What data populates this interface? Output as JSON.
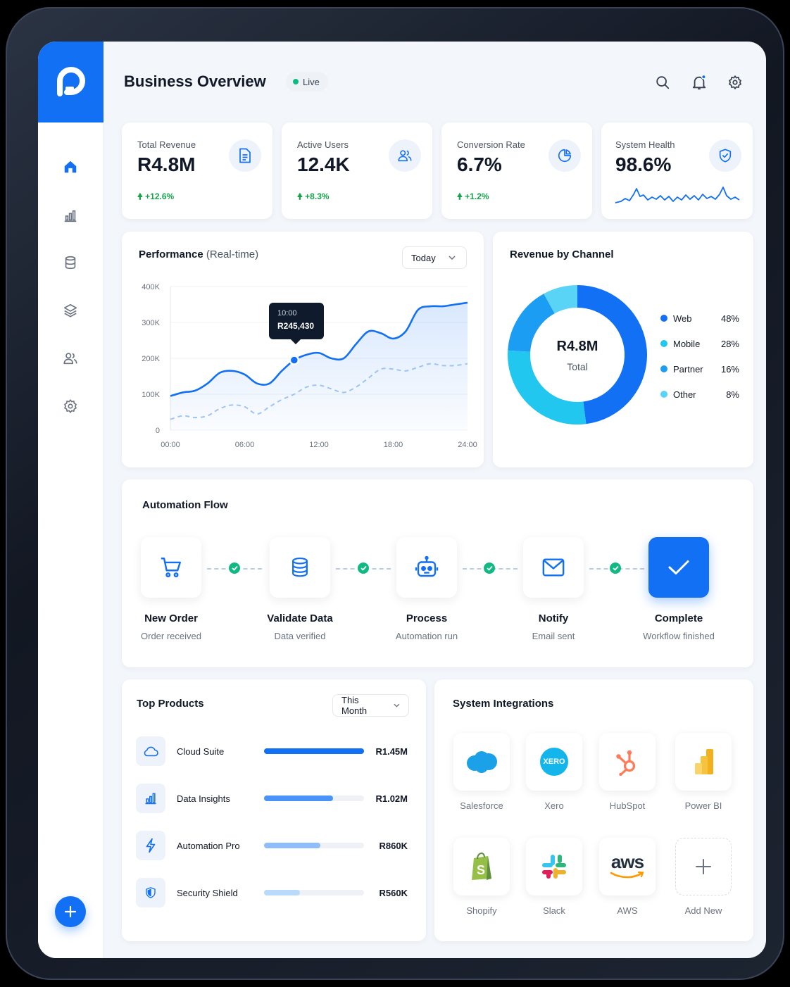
{
  "header": {
    "title": "Business Overview",
    "live_label": "Live"
  },
  "icons": {
    "header": [
      "search-icon",
      "bell-icon",
      "gear-icon"
    ],
    "sidebar": [
      "home-icon",
      "bar-chart-icon",
      "database-icon",
      "layers-icon",
      "users-icon",
      "gear-icon"
    ],
    "fab": "plus-icon"
  },
  "colors": {
    "primary": "#1270f5",
    "positive": "#16a34a",
    "success": "#10b981",
    "background": "#f3f6fb"
  },
  "stats": [
    {
      "label": "Total Revenue",
      "value": "R4.8M",
      "change": "+12.6%",
      "icon": "document-icon"
    },
    {
      "label": "Active Users",
      "value": "12.4K",
      "change": "+8.3%",
      "icon": "users-icon"
    },
    {
      "label": "Conversion Rate",
      "value": "6.7%",
      "change": "+1.2%",
      "icon": "pie-icon"
    },
    {
      "label": "System Health",
      "value": "98.6%",
      "icon": "shield-check-icon"
    }
  ],
  "performance": {
    "title": "Performance",
    "subtitle": "(Real-time)",
    "range": "Today",
    "tooltip": {
      "time": "10:00",
      "value": "R245,430"
    }
  },
  "chart_data": {
    "type": "area",
    "x": [
      "00:00",
      "01:00",
      "02:00",
      "03:00",
      "04:00",
      "05:00",
      "06:00",
      "07:00",
      "08:00",
      "09:00",
      "10:00",
      "11:00",
      "12:00",
      "13:00",
      "14:00",
      "15:00",
      "16:00",
      "17:00",
      "18:00",
      "19:00",
      "20:00",
      "21:00",
      "22:00",
      "23:00",
      "24:00"
    ],
    "x_ticks": [
      "00:00",
      "06:00",
      "12:00",
      "18:00",
      "24:00"
    ],
    "y_ticks": [
      "0",
      "100K",
      "200K",
      "300K",
      "400K"
    ],
    "ylim": [
      0,
      400000
    ],
    "series": [
      {
        "values": [
          95000,
          105000,
          110000,
          130000,
          160000,
          165000,
          155000,
          130000,
          130000,
          165000,
          195000,
          210000,
          215000,
          200000,
          200000,
          240000,
          275000,
          270000,
          255000,
          275000,
          335000,
          345000,
          345000,
          350000,
          355000
        ],
        "style": "solid-area"
      },
      {
        "values": [
          30000,
          40000,
          35000,
          40000,
          60000,
          70000,
          65000,
          45000,
          65000,
          85000,
          100000,
          120000,
          125000,
          115000,
          105000,
          120000,
          145000,
          170000,
          170000,
          165000,
          175000,
          185000,
          180000,
          180000,
          185000
        ],
        "style": "dashed"
      }
    ],
    "highlight": {
      "x": "10:00",
      "y": 195000
    }
  },
  "revenue_channel": {
    "title": "Revenue by Channel",
    "center_value": "R4.8M",
    "center_label": "Total",
    "channels": [
      {
        "name": "Web",
        "pct": 48,
        "label": "48%",
        "color": "#1270f5"
      },
      {
        "name": "Mobile",
        "pct": 28,
        "label": "28%",
        "color": "#22c7f0"
      },
      {
        "name": "Partner",
        "pct": 16,
        "label": "16%",
        "color": "#1a9df2"
      },
      {
        "name": "Other",
        "pct": 8,
        "label": "8%",
        "color": "#59d3f6"
      }
    ]
  },
  "automation": {
    "title": "Automation Flow",
    "steps": [
      {
        "name": "New Order",
        "sub": "Order received",
        "icon": "cart-icon"
      },
      {
        "name": "Validate Data",
        "sub": "Data verified",
        "icon": "database-icon"
      },
      {
        "name": "Process",
        "sub": "Automation run",
        "icon": "robot-icon"
      },
      {
        "name": "Notify",
        "sub": "Email sent",
        "icon": "mail-icon"
      },
      {
        "name": "Complete",
        "sub": "Workflow finished",
        "icon": "check-icon"
      }
    ]
  },
  "products": {
    "title": "Top Products",
    "range": "This Month",
    "items": [
      {
        "name": "Cloud Suite",
        "value": "R1.45M",
        "fill": 1.0,
        "icon": "cloud-icon",
        "color": "#1270f5"
      },
      {
        "name": "Data Insights",
        "value": "R1.02M",
        "fill": 0.69,
        "icon": "bar-chart-icon",
        "color": "#4a94f7"
      },
      {
        "name": "Automation Pro",
        "value": "R860K",
        "fill": 0.56,
        "icon": "bolt-icon",
        "color": "#8ebdf9"
      },
      {
        "name": "Security Shield",
        "value": "R560K",
        "fill": 0.36,
        "icon": "shield-icon",
        "color": "#b9dafb"
      }
    ]
  },
  "integrations": {
    "title": "System Integrations",
    "items": [
      {
        "name": "Salesforce",
        "icon": "salesforce-icon",
        "logo_text": ""
      },
      {
        "name": "Xero",
        "icon": "xero-icon",
        "logo_text": "XERO"
      },
      {
        "name": "HubSpot",
        "icon": "hubspot-icon",
        "logo_text": ""
      },
      {
        "name": "Power BI",
        "icon": "powerbi-icon",
        "logo_text": ""
      },
      {
        "name": "Shopify",
        "icon": "shopify-icon",
        "logo_text": "S"
      },
      {
        "name": "Slack",
        "icon": "slack-icon",
        "logo_text": ""
      },
      {
        "name": "AWS",
        "icon": "aws-icon",
        "logo_text": "aws"
      },
      {
        "name": "Add New",
        "icon": "plus-icon",
        "logo_text": ""
      }
    ]
  }
}
